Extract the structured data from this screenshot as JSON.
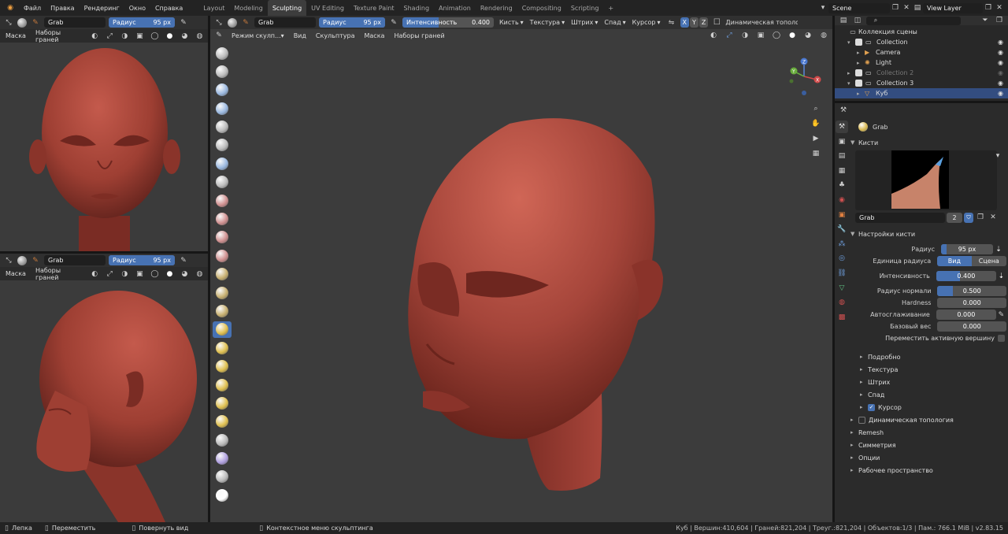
{
  "menus": [
    "Файл",
    "Правка",
    "Рендеринг",
    "Окно",
    "Справка"
  ],
  "workspaces": [
    {
      "label": "Layout",
      "active": false
    },
    {
      "label": "Modeling",
      "active": false
    },
    {
      "label": "Sculpting",
      "active": true
    },
    {
      "label": "UV Editing",
      "active": false
    },
    {
      "label": "Texture Paint",
      "active": false
    },
    {
      "label": "Shading",
      "active": false
    },
    {
      "label": "Animation",
      "active": false
    },
    {
      "label": "Rendering",
      "active": false
    },
    {
      "label": "Compositing",
      "active": false
    },
    {
      "label": "Scripting",
      "active": false
    }
  ],
  "add_workspace": "+",
  "scene": {
    "name": "Scene",
    "view_layer": "View Layer"
  },
  "left_view": {
    "brush": "Grab",
    "radius_label": "Радиус",
    "radius_value": "95 px",
    "mask": "Маска",
    "face_sets": "Наборы граней"
  },
  "main_header": {
    "brush": "Grab",
    "radius_label": "Радиус",
    "radius_value": "95 px",
    "strength_label": "Интенсивность",
    "strength_value": "0.400",
    "strength_fraction": 0.4,
    "menus": [
      "Кисть",
      "Текстура",
      "Штрих",
      "Спад",
      "Курсор"
    ],
    "axes": [
      "X",
      "Y",
      "Z"
    ],
    "dyntopo": "Динамическая тополог",
    "mode": "Режим скулп...",
    "view": "Вид",
    "sculpt": "Скульптура",
    "mask": "Маска",
    "face_sets": "Наборы граней"
  },
  "outliner": {
    "search_placeholder": "",
    "root": "Коллекция сцены",
    "items": [
      {
        "label": "Collection",
        "indent": 1,
        "kind": "collection",
        "muted": false,
        "selected": false
      },
      {
        "label": "Camera",
        "indent": 2,
        "kind": "camera",
        "muted": false,
        "selected": false
      },
      {
        "label": "Light",
        "indent": 2,
        "kind": "light",
        "muted": false,
        "selected": false
      },
      {
        "label": "Collection 2",
        "indent": 1,
        "kind": "collection",
        "muted": true,
        "selected": false
      },
      {
        "label": "Collection 3",
        "indent": 1,
        "kind": "collection",
        "muted": false,
        "selected": false
      },
      {
        "label": "Куб",
        "indent": 2,
        "kind": "mesh",
        "muted": false,
        "selected": true
      }
    ]
  },
  "properties": {
    "tool_name": "Grab",
    "brushes_title": "Кисти",
    "brush_name": "Grab",
    "brush_users": "2",
    "settings_title": "Настройки кисти",
    "radius_label": "Радиус",
    "radius_value": "95 px",
    "radius_unit_label": "Единица радиуса",
    "radius_unit_options": [
      "Вид",
      "Сцена"
    ],
    "strength_label": "Интенсивность",
    "strength_value": "0.400",
    "strength_fraction": 0.4,
    "normal_radius_label": "Радиус нормали",
    "normal_radius_value": "0.500",
    "normal_radius_fraction": 0.5,
    "hardness_label": "Hardness",
    "hardness_value": "0.000",
    "autosmooth_label": "Автосглаживание",
    "autosmooth_value": "0.000",
    "weight_label": "Базовый вес",
    "weight_value": "0.000",
    "grab_active_vertex": "Переместить активную вершину",
    "subpanels": [
      "Подробно",
      "Текстура",
      "Штрих",
      "Спад"
    ],
    "cursor": "Курсор",
    "sections": [
      "Динамическая топология",
      "Remesh",
      "Симметрия",
      "Опции",
      "Рабочее пространство"
    ]
  },
  "statusbar": {
    "left": [
      {
        "icon": "mouse-left-icon",
        "label": "Лепка"
      },
      {
        "icon": "mouse-left-icon",
        "label": "Переместить"
      },
      {
        "icon": "mouse-middle-icon",
        "label": "Повернуть вид"
      },
      {
        "icon": "mouse-right-icon",
        "label": "Контекстное меню скульптинга"
      }
    ],
    "right": "Куб | Вершин:410,604 | Граней:821,204 | Треуг.:821,204 | Объектов:1/3 | Пам.: 766.1 MiB | v2.83.15"
  },
  "colors": {
    "accent": "#4772b3",
    "skin": "#a8433a",
    "viewport": "#3b3b3b",
    "selected_row": "#334d80"
  }
}
